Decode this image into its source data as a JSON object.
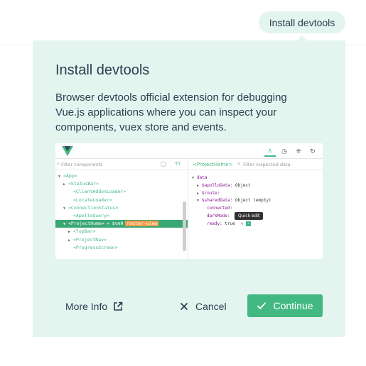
{
  "header": {
    "install_button_label": "Install devtools"
  },
  "popover": {
    "title": "Install devtools",
    "description": "Browser devtools official extension for debugging Vue.js applications where you can inspect your components, vuex store and events.",
    "preview": {
      "filter_components_placeholder": "Filter components",
      "filter_data_placeholder": "Filter inspected data",
      "selected_component": "<ProjectHome>",
      "tree": [
        {
          "name": "<App>",
          "indent": 0,
          "expanded": true
        },
        {
          "name": "<StatusBar>",
          "indent": 1,
          "expanded": false
        },
        {
          "name": "<ClientAddonLoader>",
          "indent": 2
        },
        {
          "name": "<LocaleLoader>",
          "indent": 2
        },
        {
          "name": "<ConnectionStatus>",
          "indent": 1,
          "expanded": true
        },
        {
          "name": "<ApolloQuery>",
          "indent": 2
        },
        {
          "name": "<ProjectHome>",
          "indent": 1,
          "expanded": true,
          "selected": true,
          "extra": "= $vm0",
          "tag": "router-view"
        },
        {
          "name": "<TopBar>",
          "indent": 2,
          "expanded": false
        },
        {
          "name": "<ProjectNav>",
          "indent": 2,
          "expanded": false
        },
        {
          "name": "<ProgressScreen>",
          "indent": 2
        }
      ],
      "props": [
        {
          "key": "data",
          "value": "",
          "indent": 0,
          "expanded": true
        },
        {
          "key": "$apolloData",
          "value": "Object",
          "indent": 1,
          "expanded": false
        },
        {
          "key": "$route",
          "value": "",
          "indent": 1,
          "expanded": false
        },
        {
          "key": "$sharedData",
          "value": "Object (empty)",
          "indent": 1,
          "expanded": true
        },
        {
          "key": "connected",
          "value": "",
          "indent": 2
        },
        {
          "key": "darkMode",
          "value": "",
          "indent": 2
        },
        {
          "key": "ready",
          "value": "true",
          "indent": 2
        }
      ],
      "tooltip": "Quick edit"
    }
  },
  "actions": {
    "more_info_label": "More Info",
    "cancel_label": "Cancel",
    "continue_label": "Continue"
  },
  "colors": {
    "accent": "#42b983",
    "popover_bg": "#e4f4ef",
    "text": "#2c3e50"
  },
  "icons": [
    "external-link-icon",
    "close-icon",
    "check-icon",
    "vue-logo-icon"
  ]
}
